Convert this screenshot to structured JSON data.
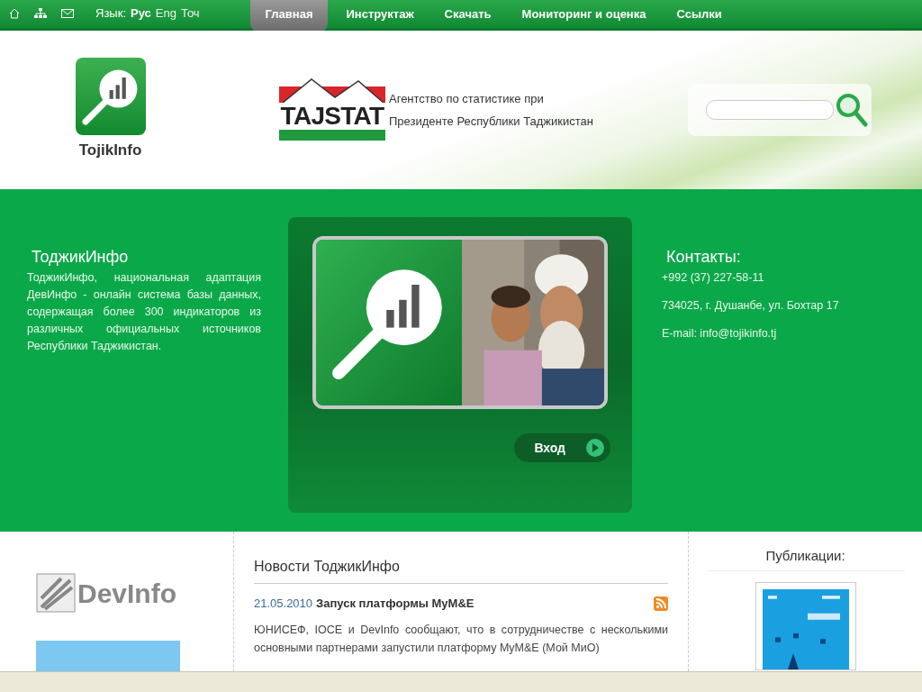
{
  "top_bar": {
    "language": {
      "label": "Язык:",
      "options": [
        {
          "label": "Рус",
          "selected": true
        },
        {
          "label": "Eng",
          "selected": false
        },
        {
          "label": "Точ",
          "selected": false
        }
      ]
    },
    "tabs": [
      {
        "label": "Главная",
        "selected": true
      },
      {
        "label": "Инструктаж",
        "selected": false
      },
      {
        "label": "Скачать",
        "selected": false
      },
      {
        "label": "Мониторинг и оценка",
        "selected": false
      },
      {
        "label": "Ссылки",
        "selected": false
      }
    ]
  },
  "header": {
    "logo_text": "TojikInfo",
    "agency_logo_text": "TAJSTAT",
    "agency_name_lines": [
      "Агентство по статистике при",
      "Президенте Республики Таджикистан"
    ]
  },
  "intro": {
    "title": "ТоджикИнфо",
    "text": "ТоджикИнфо, национальная адаптация ДевИнфо - онлайн система базы данных, содержащая более 300 индикаторов из различных официальных источников Республики Таджикистан."
  },
  "login_button": "Вход",
  "contacts": {
    "title": "Контакты:",
    "lines": [
      "+992 (37) 227-58-11",
      "734025, г. Душанбе, ул. Бохтар 17",
      "E-mail: info@tojikinfo.tj"
    ]
  },
  "devinfo_logo": "DevInfo",
  "news": {
    "title": "Новости ТоджикИнфо",
    "items": [
      {
        "date": "21.05.2010",
        "headline": "Запуск платформы MyM&E",
        "text": "ЮНИСЕФ, IOCE и DevInfo сообщают, что в сотрудничестве с несколькими основными партнерами запустили платформу MyM&E (Мой МиО)"
      }
    ]
  },
  "publications": {
    "title": "Публикации:"
  }
}
